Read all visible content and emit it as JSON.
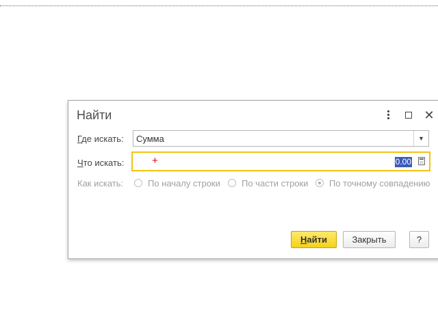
{
  "dialog": {
    "title": "Найти",
    "window_buttons": {
      "menu_icon": "vertical-dots-icon",
      "maximize_icon": "maximize-icon",
      "close_glyph": "✕"
    }
  },
  "fields": {
    "where": {
      "label_accel": "Г",
      "label_rest": "де искать:",
      "value": "Сумма",
      "dropdown_glyph": "▼"
    },
    "what": {
      "label_accel": "Ч",
      "label_rest": "то искать:",
      "value": "0.00",
      "calc_icon": "calculator-icon"
    },
    "how": {
      "label": "Как искать:",
      "options": [
        {
          "label": "По началу строки",
          "checked": false
        },
        {
          "label": "По части строки",
          "checked": false
        },
        {
          "label": "По точному совпадению",
          "checked": true
        }
      ]
    }
  },
  "buttons": {
    "find_accel": "Н",
    "find_rest": "айти",
    "close": "Закрыть",
    "help": "?"
  },
  "colors": {
    "accent_border": "#f2c314",
    "find_button": "#f5d21b",
    "selection": "#3b5cb8",
    "cursor": "#e00000"
  }
}
